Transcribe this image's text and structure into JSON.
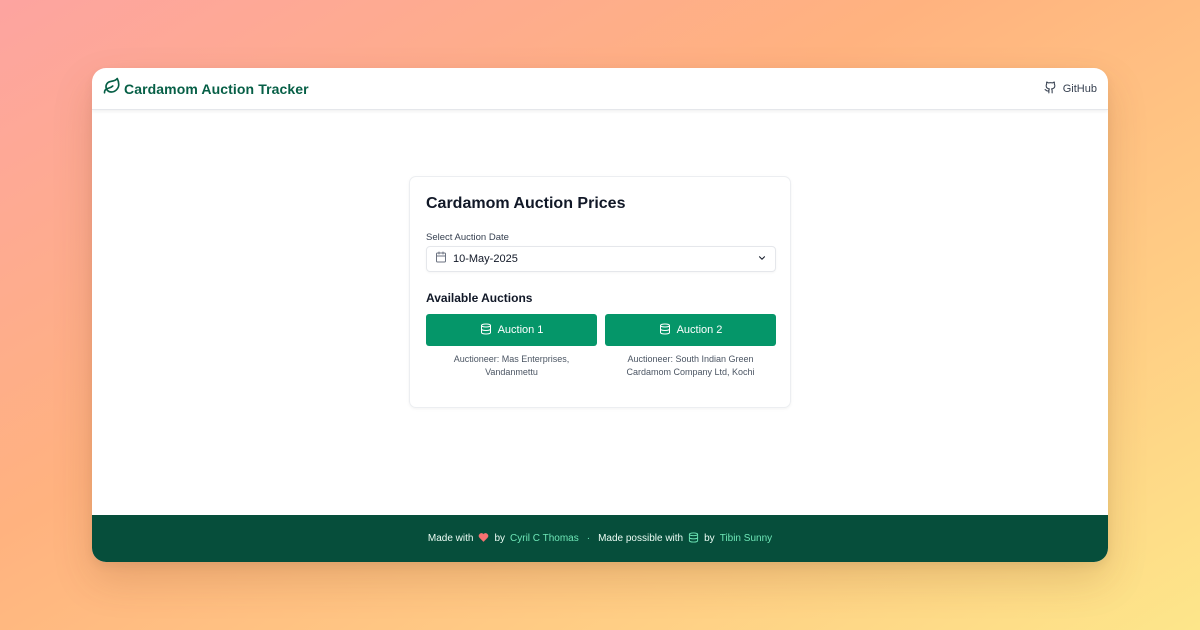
{
  "header": {
    "brand_title": "Cardamom Auction Tracker",
    "brand_icon": "leaf-icon",
    "github_label": "GitHub",
    "github_icon": "github-icon"
  },
  "card": {
    "title": "Cardamom Auction Prices",
    "date_label": "Select Auction Date",
    "date_value": "10-May-2025",
    "section_title": "Available Auctions",
    "auctions": [
      {
        "label": "Auction 1",
        "auctioneer": "Auctioneer: Mas Enterprises, Vandanmettu",
        "icon": "database-icon"
      },
      {
        "label": "Auction 2",
        "auctioneer": "Auctioneer: South Indian Green Cardamom Company Ltd, Kochi",
        "icon": "database-icon"
      }
    ]
  },
  "footer": {
    "made_with": "Made with",
    "by1": "by",
    "author": "Cyril C Thomas",
    "separator": "·",
    "made_possible": "Made possible with",
    "by2": "by",
    "contributor": "Tibin Sunny",
    "heart_icon": "heart-icon",
    "database_icon": "database-icon"
  },
  "colors": {
    "brand": "#065f46",
    "button": "#059669",
    "footer_bg": "#064e3b",
    "link": "#6ee7b7",
    "heart": "#f87171"
  }
}
